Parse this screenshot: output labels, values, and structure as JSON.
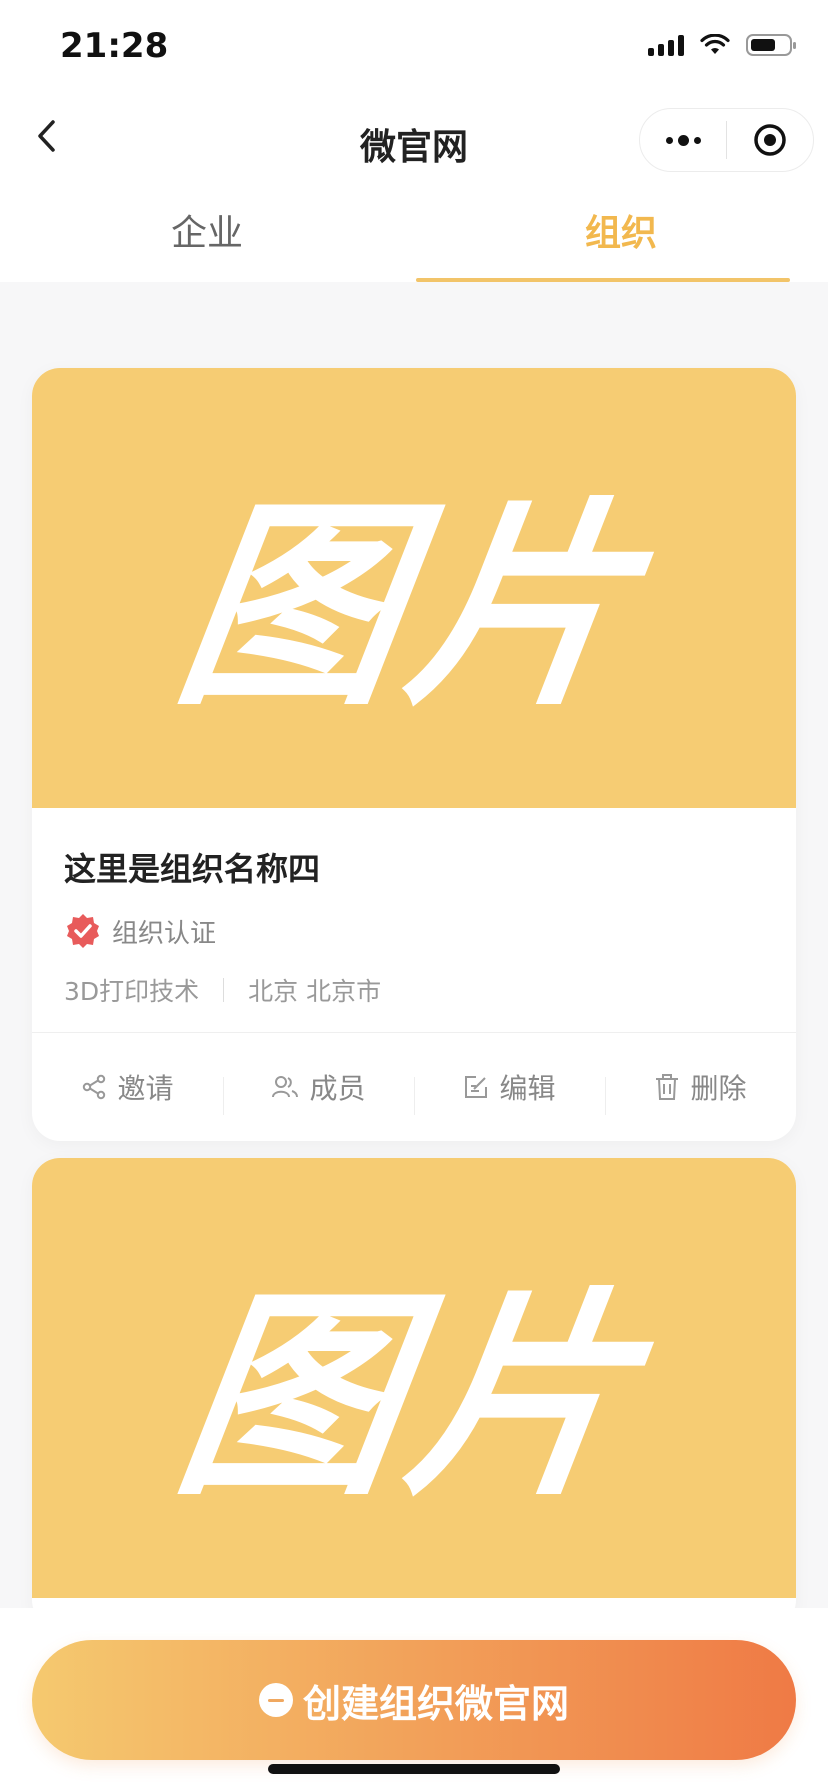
{
  "status_bar": {
    "time": "21:28"
  },
  "nav": {
    "title": "微官网"
  },
  "tabs": [
    {
      "label": "企业",
      "active": false
    },
    {
      "label": "组织",
      "active": true
    }
  ],
  "cards": [
    {
      "image_text": "图片",
      "name": "这里是组织名称四",
      "certification": "组织认证",
      "industry": "3D打印技术",
      "location": "北京 北京市",
      "actions": [
        {
          "label": "邀请",
          "icon": "share-icon"
        },
        {
          "label": "成员",
          "icon": "members-icon"
        },
        {
          "label": "编辑",
          "icon": "edit-icon"
        },
        {
          "label": "删除",
          "icon": "trash-icon"
        }
      ]
    },
    {
      "image_text": "图片"
    }
  ],
  "create_button": {
    "label": "创建组织微官网"
  },
  "colors": {
    "accent": "#f2b84e",
    "image_bg": "#f6cc73",
    "button_start": "#f5c96f",
    "button_end": "#ef7a45",
    "cert_badge": "#e85b5b"
  }
}
